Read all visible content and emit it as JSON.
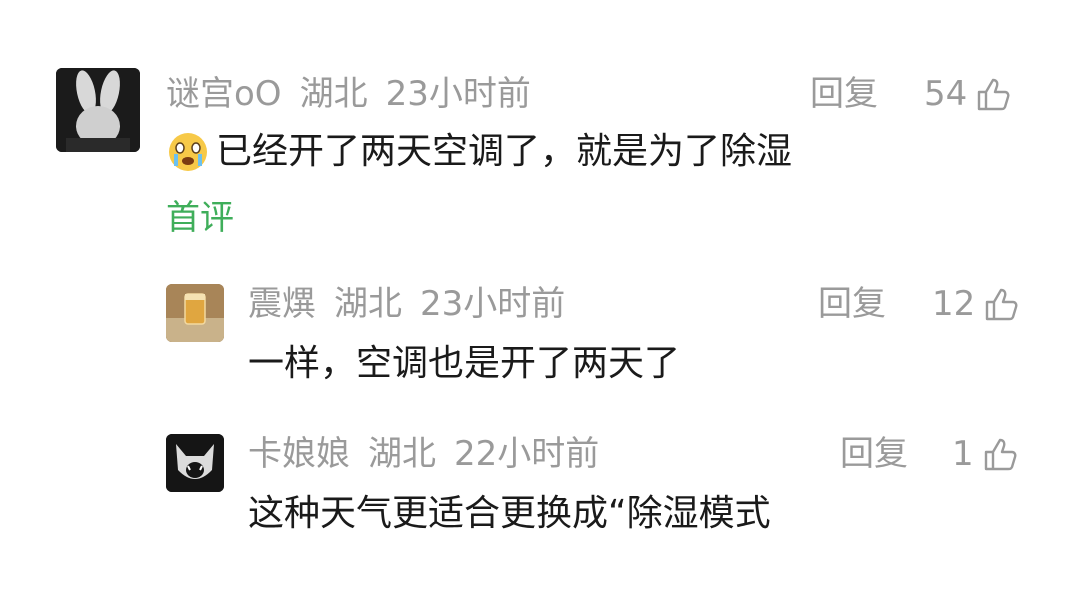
{
  "comments": [
    {
      "username": "谜宫oO",
      "location": "湖北",
      "time": "23小时前",
      "reply_label": "回复",
      "likes": "54",
      "emoji": "crying-face",
      "text": "已经开了两天空调了，就是为了除湿",
      "badge": "首评",
      "avatar": "rabbit-silhouette"
    },
    {
      "username": "震熼",
      "location": "湖北",
      "time": "23小时前",
      "reply_label": "回复",
      "likes": "12",
      "text": "一样，空调也是开了两天了",
      "avatar": "tea-glass"
    },
    {
      "username": "卡娘娘",
      "location": "湖北",
      "time": "22小时前",
      "reply_label": "回复",
      "likes": "1",
      "text": "这种天气更适合更换成“除湿模式",
      "avatar": "roaring-cat"
    }
  ],
  "colors": {
    "meta": "#9a9a9a",
    "text": "#1a1a1a",
    "badge": "#3fae5a"
  }
}
